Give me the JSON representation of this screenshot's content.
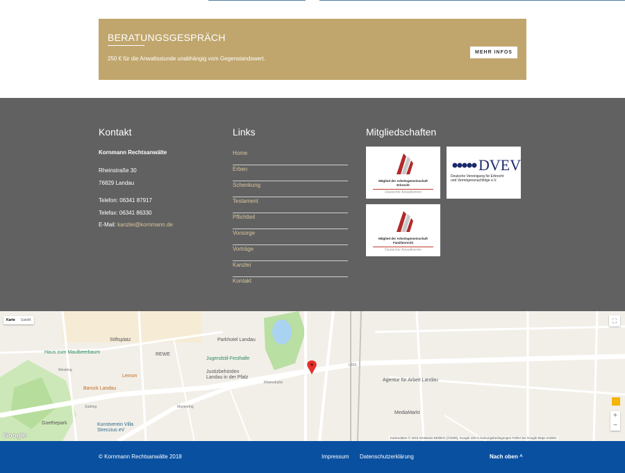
{
  "consultation": {
    "title": "BERATUNGSGESPRÄCH",
    "text": "250 € für die Anwaltsstunde unabhängig vom Gegenstandswert.",
    "button": "MEHR INFOS"
  },
  "footer": {
    "kontakt": {
      "heading": "Kontakt",
      "firm": "Kornmann Rechtsanwälte",
      "street": "Rheinstraße 30",
      "city": "76829 Landau",
      "phone": "Telefon: 06341 87917",
      "fax": "Telefax: 06341 86330",
      "email_label": "E-Mail:",
      "email": "kanzlei@kornmann.de"
    },
    "links": {
      "heading": "Links",
      "items": [
        "Home",
        "Erben",
        "Schenkung",
        "Testament",
        "Pflichtteil",
        "Vorsorge",
        "Vorträge",
        "Kanzlei",
        "Kontakt"
      ]
    },
    "memberships": {
      "heading": "Mitgliedschaften",
      "badges": [
        {
          "caption": "Mitglied der Arbeitsgemeinschaft",
          "field": "Erbrecht",
          "org": "Deutscher Anwaltverein"
        },
        {
          "caption": "Mitglied der Arbeitsgemeinschaft",
          "field": "Familienrecht",
          "org": "Deutscher Anwaltverein"
        }
      ],
      "dvev": {
        "abbr": "DVEV",
        "line1": "Deutsche Vereinigung für Erbrecht",
        "line2": "und Vermögensnachfolge e.V."
      }
    }
  },
  "map": {
    "type_map": "Karte",
    "type_satellite": "Satellit",
    "labels": [
      "Stiftsplatz",
      "Haus zum Maulbeerbaum",
      "REWE",
      "Parkhotel Landau",
      "Jugendstil-Festhalle",
      "Justizbehörden Landau in der Pfalz",
      "Lemon",
      "Barock Landau",
      "Goethepark",
      "Kunstverein Villa Streccius eV",
      "Agentur für Arbeit Landau",
      "MediaMarkt",
      "Rheinstraße",
      "Südring",
      "Marienring",
      "L509",
      "Westring"
    ],
    "attribution": "Kartendaten © 2018 GeoBasis-DE/BKG (©2009), Google   100 m          Nutzungsbedingungen    Fehler bei Google Maps melden",
    "logo": "Google",
    "zoom_in": "+",
    "zoom_out": "−"
  },
  "bottom_bar": {
    "copyright": "© Kornmann Rechtsanwälte 2018",
    "impressum": "Impressum",
    "privacy": "Datenschutzerklärung",
    "to_top": "Nach oben ^"
  },
  "colors": {
    "gold": "#c0a66d",
    "grey": "#616161",
    "blue": "#0950a0",
    "link": "#d8c69c"
  }
}
